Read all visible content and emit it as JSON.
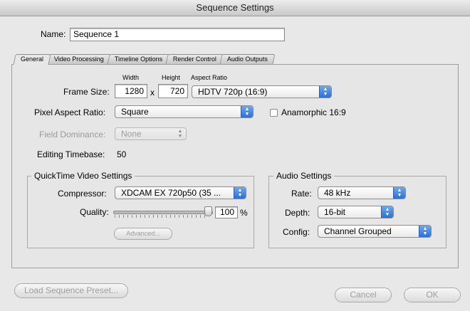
{
  "window": {
    "title": "Sequence Settings"
  },
  "name": {
    "label": "Name:",
    "value": "Sequence 1"
  },
  "tabs": [
    {
      "label": "General"
    },
    {
      "label": "Video Processing"
    },
    {
      "label": "Timeline Options"
    },
    {
      "label": "Render Control"
    },
    {
      "label": "Audio Outputs"
    }
  ],
  "frame_size": {
    "label": "Frame Size:",
    "width_caption": "Width",
    "height_caption": "Height",
    "aspect_caption": "Aspect Ratio",
    "width": "1280",
    "separator": "x",
    "height": "720",
    "aspect": "HDTV 720p (16:9)"
  },
  "pixel_aspect": {
    "label": "Pixel Aspect Ratio:",
    "value": "Square",
    "anamorphic_label": "Anamorphic 16:9",
    "anamorphic_checked": false
  },
  "field_dominance": {
    "label": "Field Dominance:",
    "value": "None"
  },
  "timebase": {
    "label": "Editing Timebase:",
    "value": "50"
  },
  "quicktime": {
    "title": "QuickTime Video Settings",
    "compressor_label": "Compressor:",
    "compressor": "XDCAM EX 720p50 (35 ...",
    "quality_label": "Quality:",
    "quality_value": "100",
    "quality_unit": "%",
    "quality_level": 1.0,
    "advanced_label": "Advanced..."
  },
  "audio": {
    "title": "Audio Settings",
    "rate_label": "Rate:",
    "rate": "48 kHz",
    "depth_label": "Depth:",
    "depth": "16-bit",
    "config_label": "Config:",
    "config": "Channel Grouped"
  },
  "footer": {
    "load_preset": "Load Sequence Preset...",
    "cancel": "Cancel",
    "ok": "OK"
  }
}
